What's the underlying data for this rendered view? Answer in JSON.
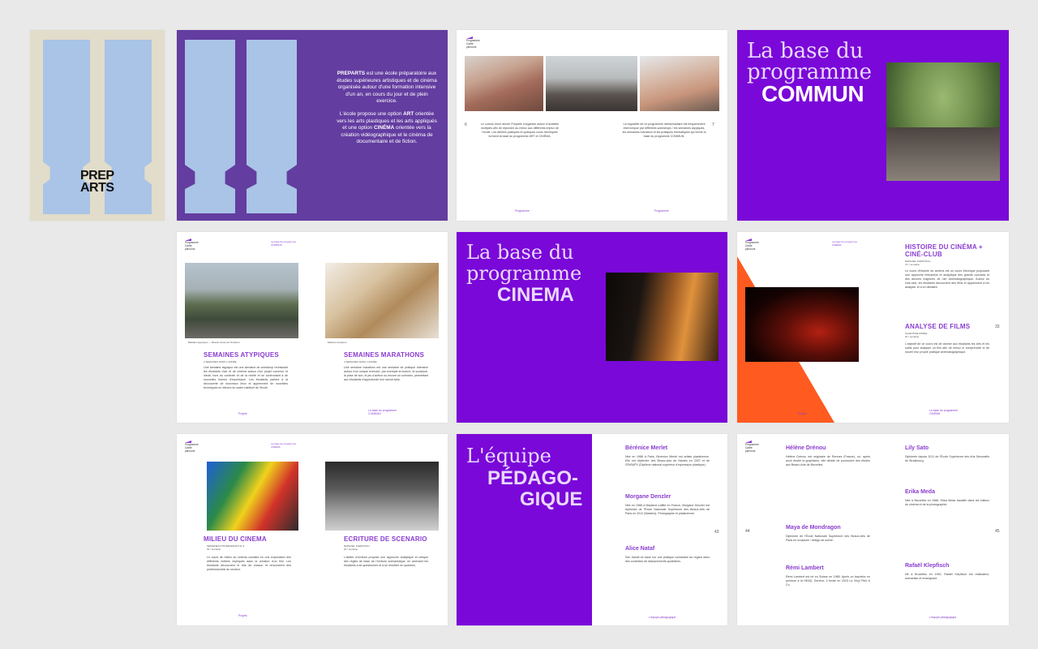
{
  "cover": {
    "logo_line1": "PREP",
    "logo_line2": "ARTS"
  },
  "intro": {
    "para1_strong": "PREPARTS",
    "para1": " est une école préparatoire aux études supérieures artistiques et de cinéma organisée autour d'une formation intensive d'un an, en cours du jour et de plein exercice.",
    "para2_a": "L'école propose une option ",
    "para2_art": "ART",
    "para2_b": " orientée vers les arts plastiques et les arts appliqués et une option ",
    "para2_cinema": "CINÉMA",
    "para2_c": " orientée vers la création vidéographique et le cinéma de documentaire et de fiction."
  },
  "spread_programme": {
    "logo": "Programme\nCadre\nparcours",
    "page_left": "6",
    "page_right": "7",
    "text_left": "Le cursus d'une année Preparts s'organise autour d'activités multiples afin de répondre au mieux aux différents enjeux de l'école. Les ateliers pratiques et quelques cours théoriques forment la base du programme ART et CINÉMA.",
    "text_right": "La régularité de ce programme hebdomadaire est fréquemment interrompue par différents workshops / les semaines atypiques, les semaines marathon et les pratiques thématiques qui forme la base du programme COMMUN.",
    "foot_left": "Programme",
    "foot_right": "Programme"
  },
  "commun_title": {
    "line1": "La base du",
    "line2": "programme",
    "line3": "COMMUN"
  },
  "semaines": {
    "logo": "Programme\nCadre\nparcours",
    "header": "La base du programme\nCOMMUN",
    "caption_left": "Balades atypiques — Bassin-Hutte de Charleroi",
    "caption_right": "Matériel sculpture",
    "title_left": "SEMAINES ATYPIQUES",
    "sub_left": "2 SEMAINES DANS L'ANNÉE",
    "text_left": "Une semaine atypique est une semaine de workshop réunissant les étudiants d'art et de cinéma autour d'un projet commun et inédit, hors du contexte et de la mixité et se confrontant à de nouvelles formes d'expression. Les étudiants partent à la découverte de nouveaux lieux et apprennent de nouvelles techniques en dehors du cadre habituel de l'école.",
    "title_right": "SEMAINES MARATHONS",
    "sub_right": "4 SEMAINES DANS L'ANNÉE",
    "text_right": "Une semaine marathon est une semaine de pratique intensive autour d'un unique exercice, par exemple la lecture, la sculpture, la prise de son, le jeu d'acteur ou encore un scénario, permettant aux étudiants d'approfondir leur savoir-faire.",
    "foot_left": "Projets",
    "foot_right": "La base du programme\nCOMMUN"
  },
  "cinema_title": {
    "line1": "La base du",
    "line2": "programme",
    "line3": "CINEMA"
  },
  "histoire": {
    "logo": "Programme\nCadre\nparcours",
    "header": "La base du programme\nCINÉMA",
    "title": "HISTOIRE DU CINÉMA +\nCINÉ-CLUB",
    "teacher1": "RAPHAËL KLEPFISCH\n3 h / semaine",
    "text1": "Le cours d'histoire du cinéma est un cours théorique proposant une approche interactive et analytique des grands courants et des œuvres majeures de l'art cinématographique. Autour du ciné-club, les étudiants découvrent des films et apprennent à les analyser et à en débattre.",
    "title2": "ANALYSE DE FILMS",
    "teacher2": "VALENTINE MOREL\n2h / semaine",
    "text2": "L'objectif de ce cours est de donner aux étudiants les clés et les outils pour analyser un film afin de mieux le comprendre et de nourrir leur propre pratique cinématographique.",
    "page": "33",
    "foot": "Projets",
    "foot_right": "La base du programme\nCINÉMA"
  },
  "milieu": {
    "logo": "Programme\nCadre\nparcours",
    "header": "La base du programme\nCINÉMA",
    "title_left": "MILIEU DU CINEMA",
    "sub_left": "SEMAINES D'INTERVENANT·E·S\n3h / semaine",
    "text_left": "Le cours de milieu du cinéma consiste en une exploration des différents métiers impliqués dans la création d'un film. Les étudiants découvrent le rôle de chacun et rencontrent des professionnels du secteur.",
    "title_right": "ECRITURE DE SCENARIO",
    "sub_right": "RAPHAËL KLEPFISCH\n2h / semaine",
    "text_right": "L'atelier d'écriture propose une approche analytique et critique des règles de base de l'écriture scénaristique, en amenant les étudiants à se questionner et à se remettre en question.",
    "foot": "Projets"
  },
  "equipe": {
    "title_line1": "L'équipe",
    "title_line2": "PÉDAGO-",
    "title_line3": "GIQUE",
    "names": [
      "Bérénice Merlet",
      "Morgane Denzler",
      "Alice Nataf"
    ],
    "bios": [
      "Née en 1988 à Paris, Bérénice Merlet est artiste plasticienne. Elle est diplômée des Beaux-Arts de Nantes en 2007 et de l'ENSAPV (Diplôme national supérieur d'expression plastique).",
      "Née en 1988 à Madame-Lafitte en France, Morgane Denzler est diplômée de l'École Nationale Supérieure des Beaux-Arts de Paris en 2012 (Masters). Photographe et plasticienne.",
      "Son travail se base sur une pratique consistant au regard dans des contextes de déplacements quotidiens."
    ],
    "page": "43",
    "foot": "L'équipe pédagogique"
  },
  "equipe2": {
    "logo": "Programme\nCadre\nparcours",
    "names_left": [
      "Hélène Drénou",
      "Maya de Mondragon",
      "Rémi Lambert"
    ],
    "bios_left": [
      "Hélène Drénou est originaire de Rennes (France), où, après avoir étudié la graphisme, elle décide de poursuivre des études aux Beaux-Arts de Bruxelles.",
      "Diplômée de l'École Nationale Supérieure des Beaux-Arts de Paris en sculpture / design de scène.",
      "Rémi Lambert est né en Suisse en 1985. Après un bachelor en peinture à la HEAD, Genève, il fonde en 2015 La Vinyl Pink & Co."
    ],
    "names_right": [
      "Lily Sato",
      "Erika Meda",
      "Rafaël Klepfisch"
    ],
    "bios_right": [
      "Diplômée depuis 2011 de l'École Supérieure des Arts Décoratifs de Strasbourg.",
      "Née à Bruxelles en 1986, Erika Meda travaille dans les milieux du cinéma et de la photographie.",
      "Né à Bruxelles en 1992, Rafaël Klepfisch est réalisateur, scénariste et enseignant."
    ],
    "page_left": "44",
    "page_right": "45",
    "foot": "L'équipe pédagogique"
  },
  "colors": {
    "violet": "#7a08d8",
    "deep_violet": "#633da0",
    "window_blue": "#a9c4e6",
    "cream": "#e2dccb",
    "accent_orange": "#ff5a1f"
  }
}
